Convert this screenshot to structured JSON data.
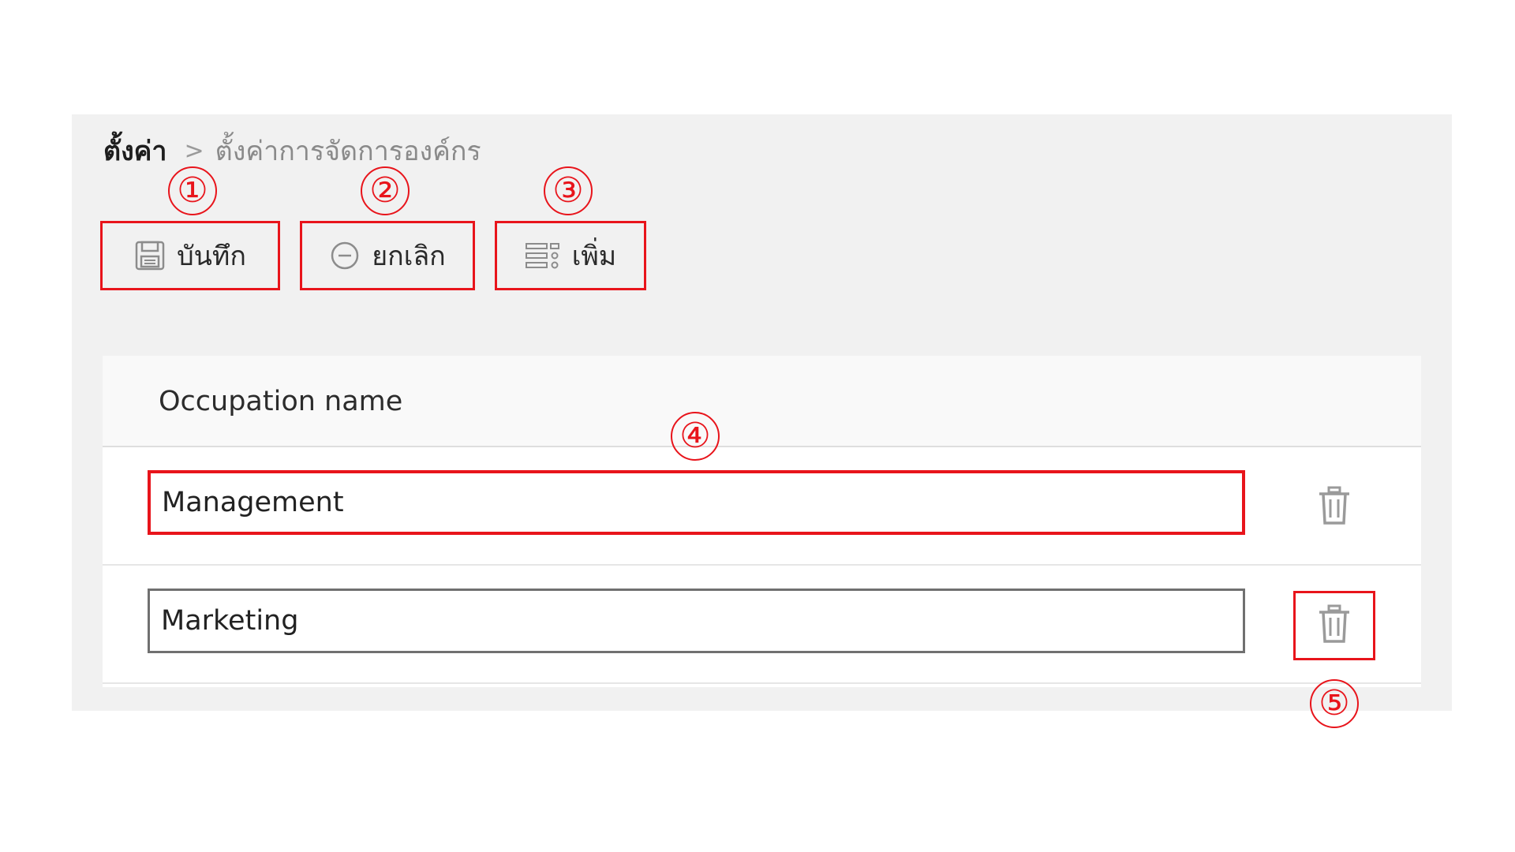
{
  "breadcrumb": {
    "root": "ตั้งค่า",
    "separator": ">",
    "current": "ตั้งค่าการจัดการองค์กร"
  },
  "toolbar": {
    "save_label": "บันทึก",
    "cancel_label": "ยกเลิก",
    "add_label": "เพิ่ม"
  },
  "markers": [
    "①",
    "②",
    "③",
    "④",
    "⑤"
  ],
  "table": {
    "column_header": "Occupation name",
    "rows": [
      {
        "value": "Management"
      },
      {
        "value": "Marketing"
      }
    ]
  },
  "colors": {
    "highlight": "#e8141b",
    "panel_bg": "#f1f1f1",
    "header_bg": "#f9f9f9"
  },
  "icons": {
    "save": "floppy-disk-icon",
    "cancel": "minus-circle-icon",
    "add": "list-add-icon",
    "delete": "trash-icon"
  }
}
